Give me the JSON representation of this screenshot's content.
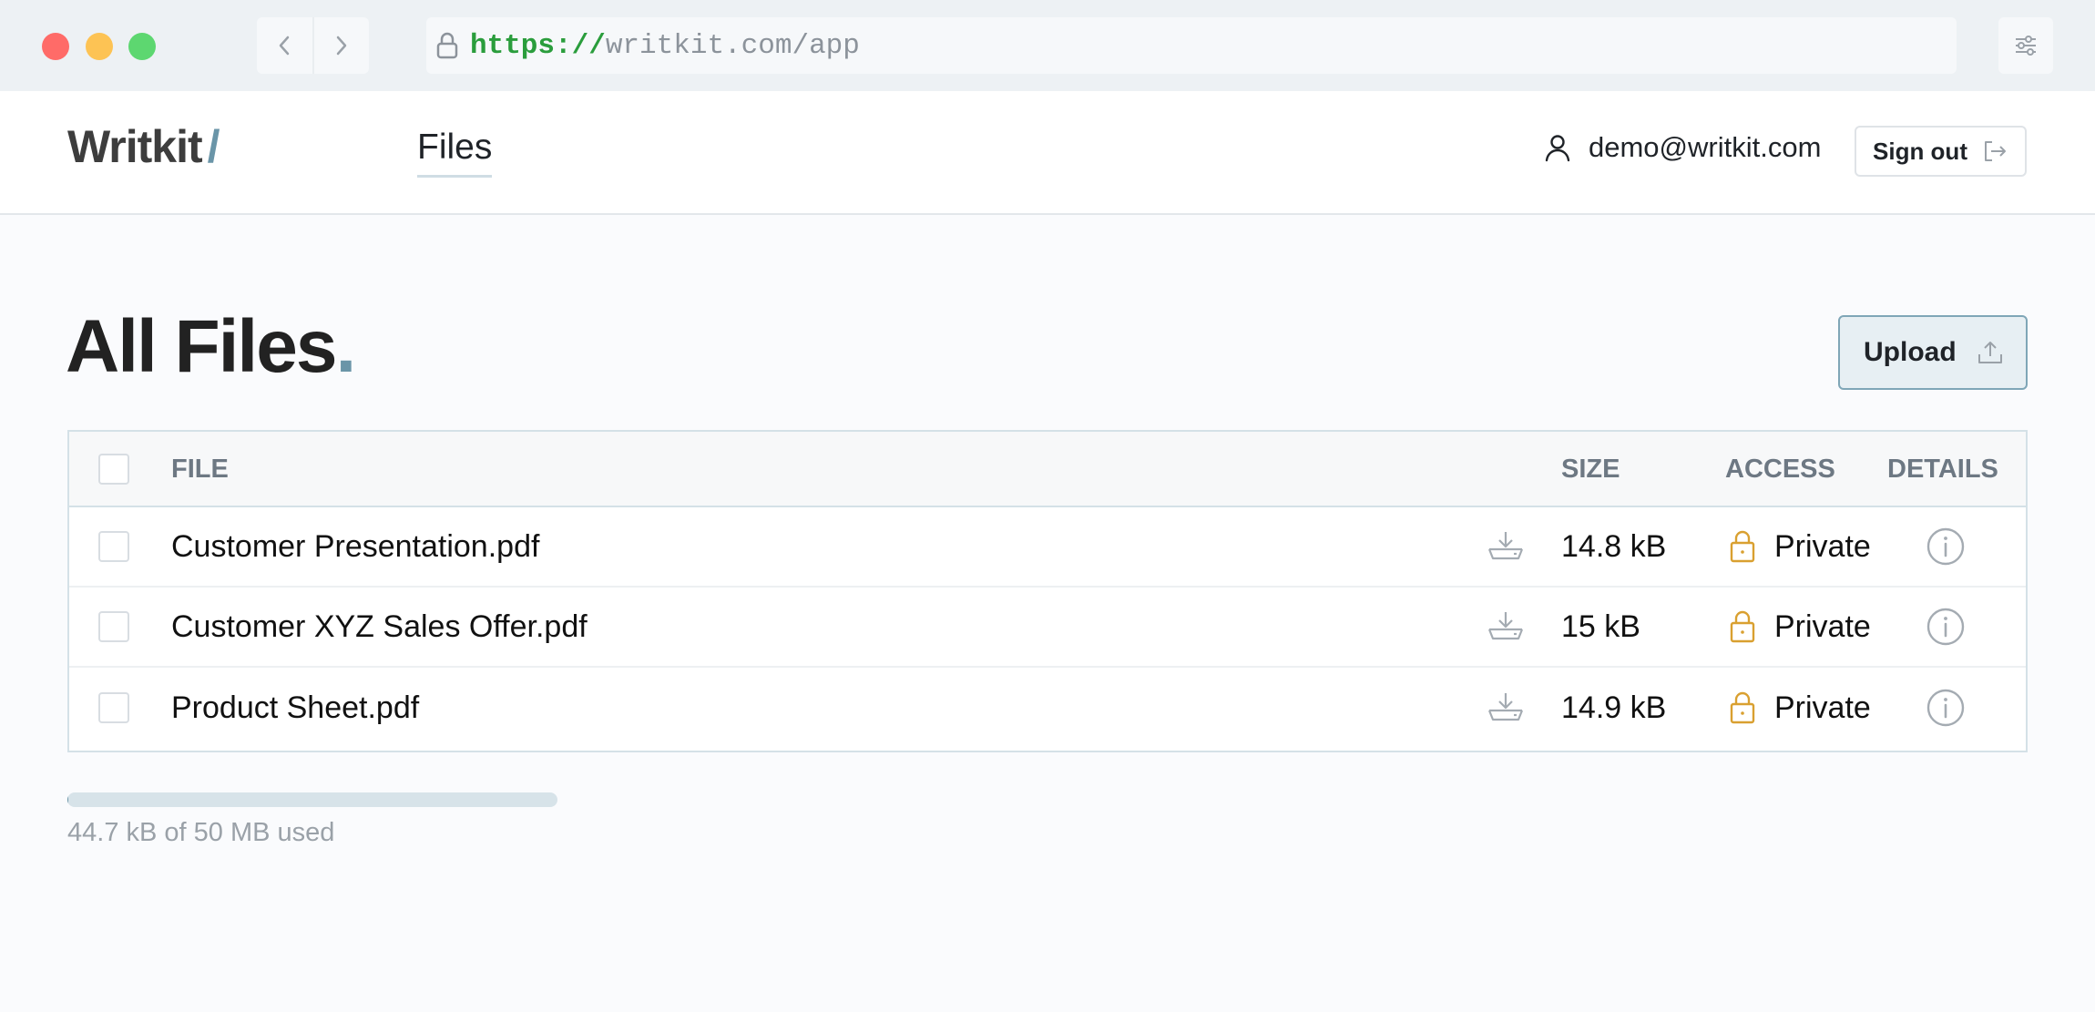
{
  "browser": {
    "url_scheme": "https://",
    "url_rest": "writkit.com/app"
  },
  "header": {
    "logo_text": "Writkit",
    "logo_slash": "/",
    "nav_files": "Files",
    "user_email": "demo@writkit.com",
    "sign_out_label": "Sign out"
  },
  "main": {
    "title": "All Files",
    "title_dot": ".",
    "upload_label": "Upload"
  },
  "table": {
    "headers": {
      "file": "FILE",
      "size": "SIZE",
      "access": "ACCESS",
      "details": "DETAILS"
    },
    "rows": [
      {
        "name": "Customer Presentation.pdf",
        "size": "14.8 kB",
        "access": "Private"
      },
      {
        "name": "Customer XYZ Sales Offer.pdf",
        "size": "15 kB",
        "access": "Private"
      },
      {
        "name": "Product Sheet.pdf",
        "size": "14.9 kB",
        "access": "Private"
      }
    ]
  },
  "storage": {
    "usage_text": "44.7 kB of 50 MB used",
    "used_fraction": 0.000894
  },
  "colors": {
    "accent": "#6a95a8",
    "lock_amber": "#d9a030",
    "url_green": "#2a9d3c"
  },
  "icons": {
    "lock": "lock-icon",
    "back": "chevron-left-icon",
    "forward": "chevron-right-icon",
    "settings": "sliders-icon",
    "user": "user-icon",
    "sign_out": "sign-out-icon",
    "upload": "upload-icon",
    "download": "download-icon",
    "private": "padlock-icon",
    "info": "info-icon"
  }
}
